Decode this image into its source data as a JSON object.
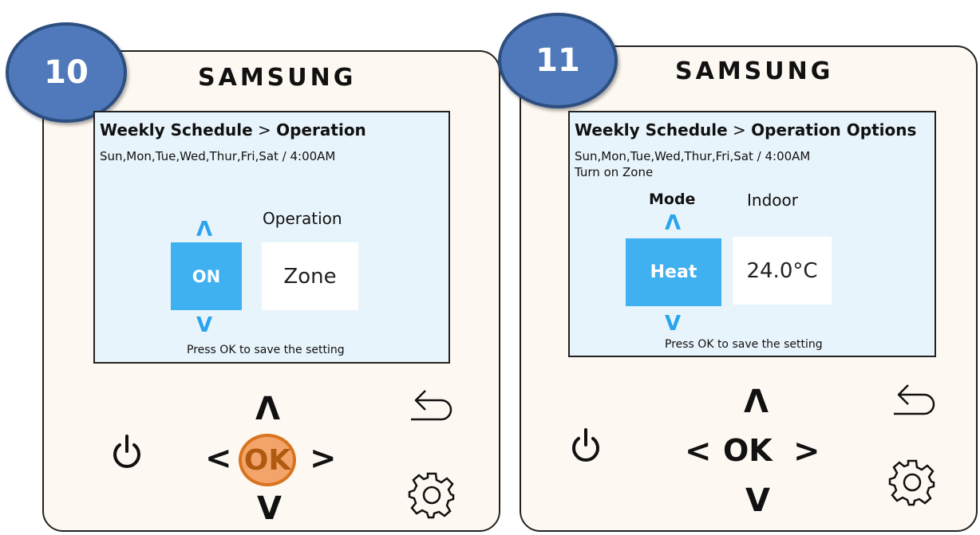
{
  "brand": "SAMSUNG",
  "colors": {
    "panel_bg": "#fdf8f1",
    "screen_bg": "#e8f4fb",
    "accent": "#3fb0f0",
    "badge": "#4f79ba",
    "ok_highlight": "#f2a46a"
  },
  "steps": [
    {
      "number": "10",
      "title_main": "Weekly Schedule",
      "title_sep": " > ",
      "title_sub": "Operation",
      "days": "Sun,Mon,Tue,Wed,Thur,Fri,Sat / 4:00AM",
      "column_label": "Operation",
      "selected_value": "ON",
      "field_value": "Zone",
      "hint": "Press OK to save the setting",
      "up_arrow": "Λ",
      "down_arrow": "V",
      "ok_label": "OK",
      "ok_highlighted": true
    },
    {
      "number": "11",
      "title_main": "Weekly Schedule",
      "title_sep": " > ",
      "title_sub": "Operation Options",
      "days": "Sun,Mon,Tue,Wed,Thur,Fri,Sat / 4:00AM",
      "extra_line": "Turn on Zone",
      "mode_label": "Mode",
      "indoor_label": "Indoor",
      "selected_value": "Heat",
      "field_value": "24.0°C",
      "hint": "Press OK to save the setting",
      "up_arrow": "Λ",
      "down_arrow": "V",
      "ok_label": "OK",
      "ok_highlighted": false
    }
  ],
  "controls": {
    "left": "<",
    "right": ">",
    "up": "Λ",
    "down": "V"
  },
  "icons": [
    "power-icon",
    "back-arrow-icon",
    "gear-icon"
  ]
}
